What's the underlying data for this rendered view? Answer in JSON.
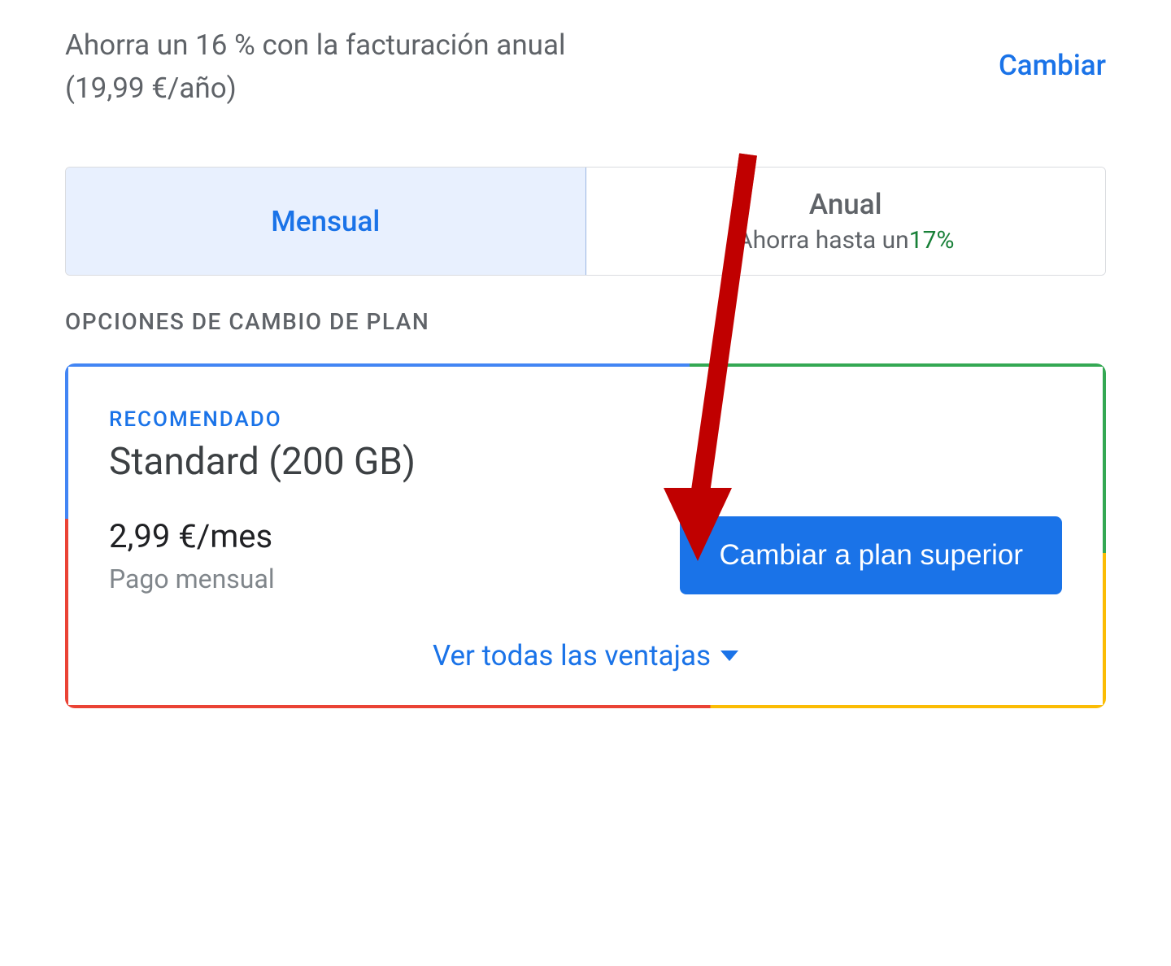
{
  "header": {
    "savings_text": "Ahorra un 16 % con la facturación anual (19,99 €/año)",
    "change_link": "Cambiar"
  },
  "tabs": {
    "monthly": {
      "label": "Mensual"
    },
    "annual": {
      "label": "Anual",
      "sublabel_prefix": "Ahorra hasta un",
      "percent": "17%"
    }
  },
  "section_label": "OPCIONES DE CAMBIO DE PLAN",
  "plan_card": {
    "recommended": "RECOMENDADO",
    "name": "Standard (200 GB)",
    "price": "2,99 €/mes",
    "payment_type": "Pago mensual",
    "upgrade_button": "Cambiar a plan superior",
    "see_benefits": "Ver todas las ventajas"
  }
}
